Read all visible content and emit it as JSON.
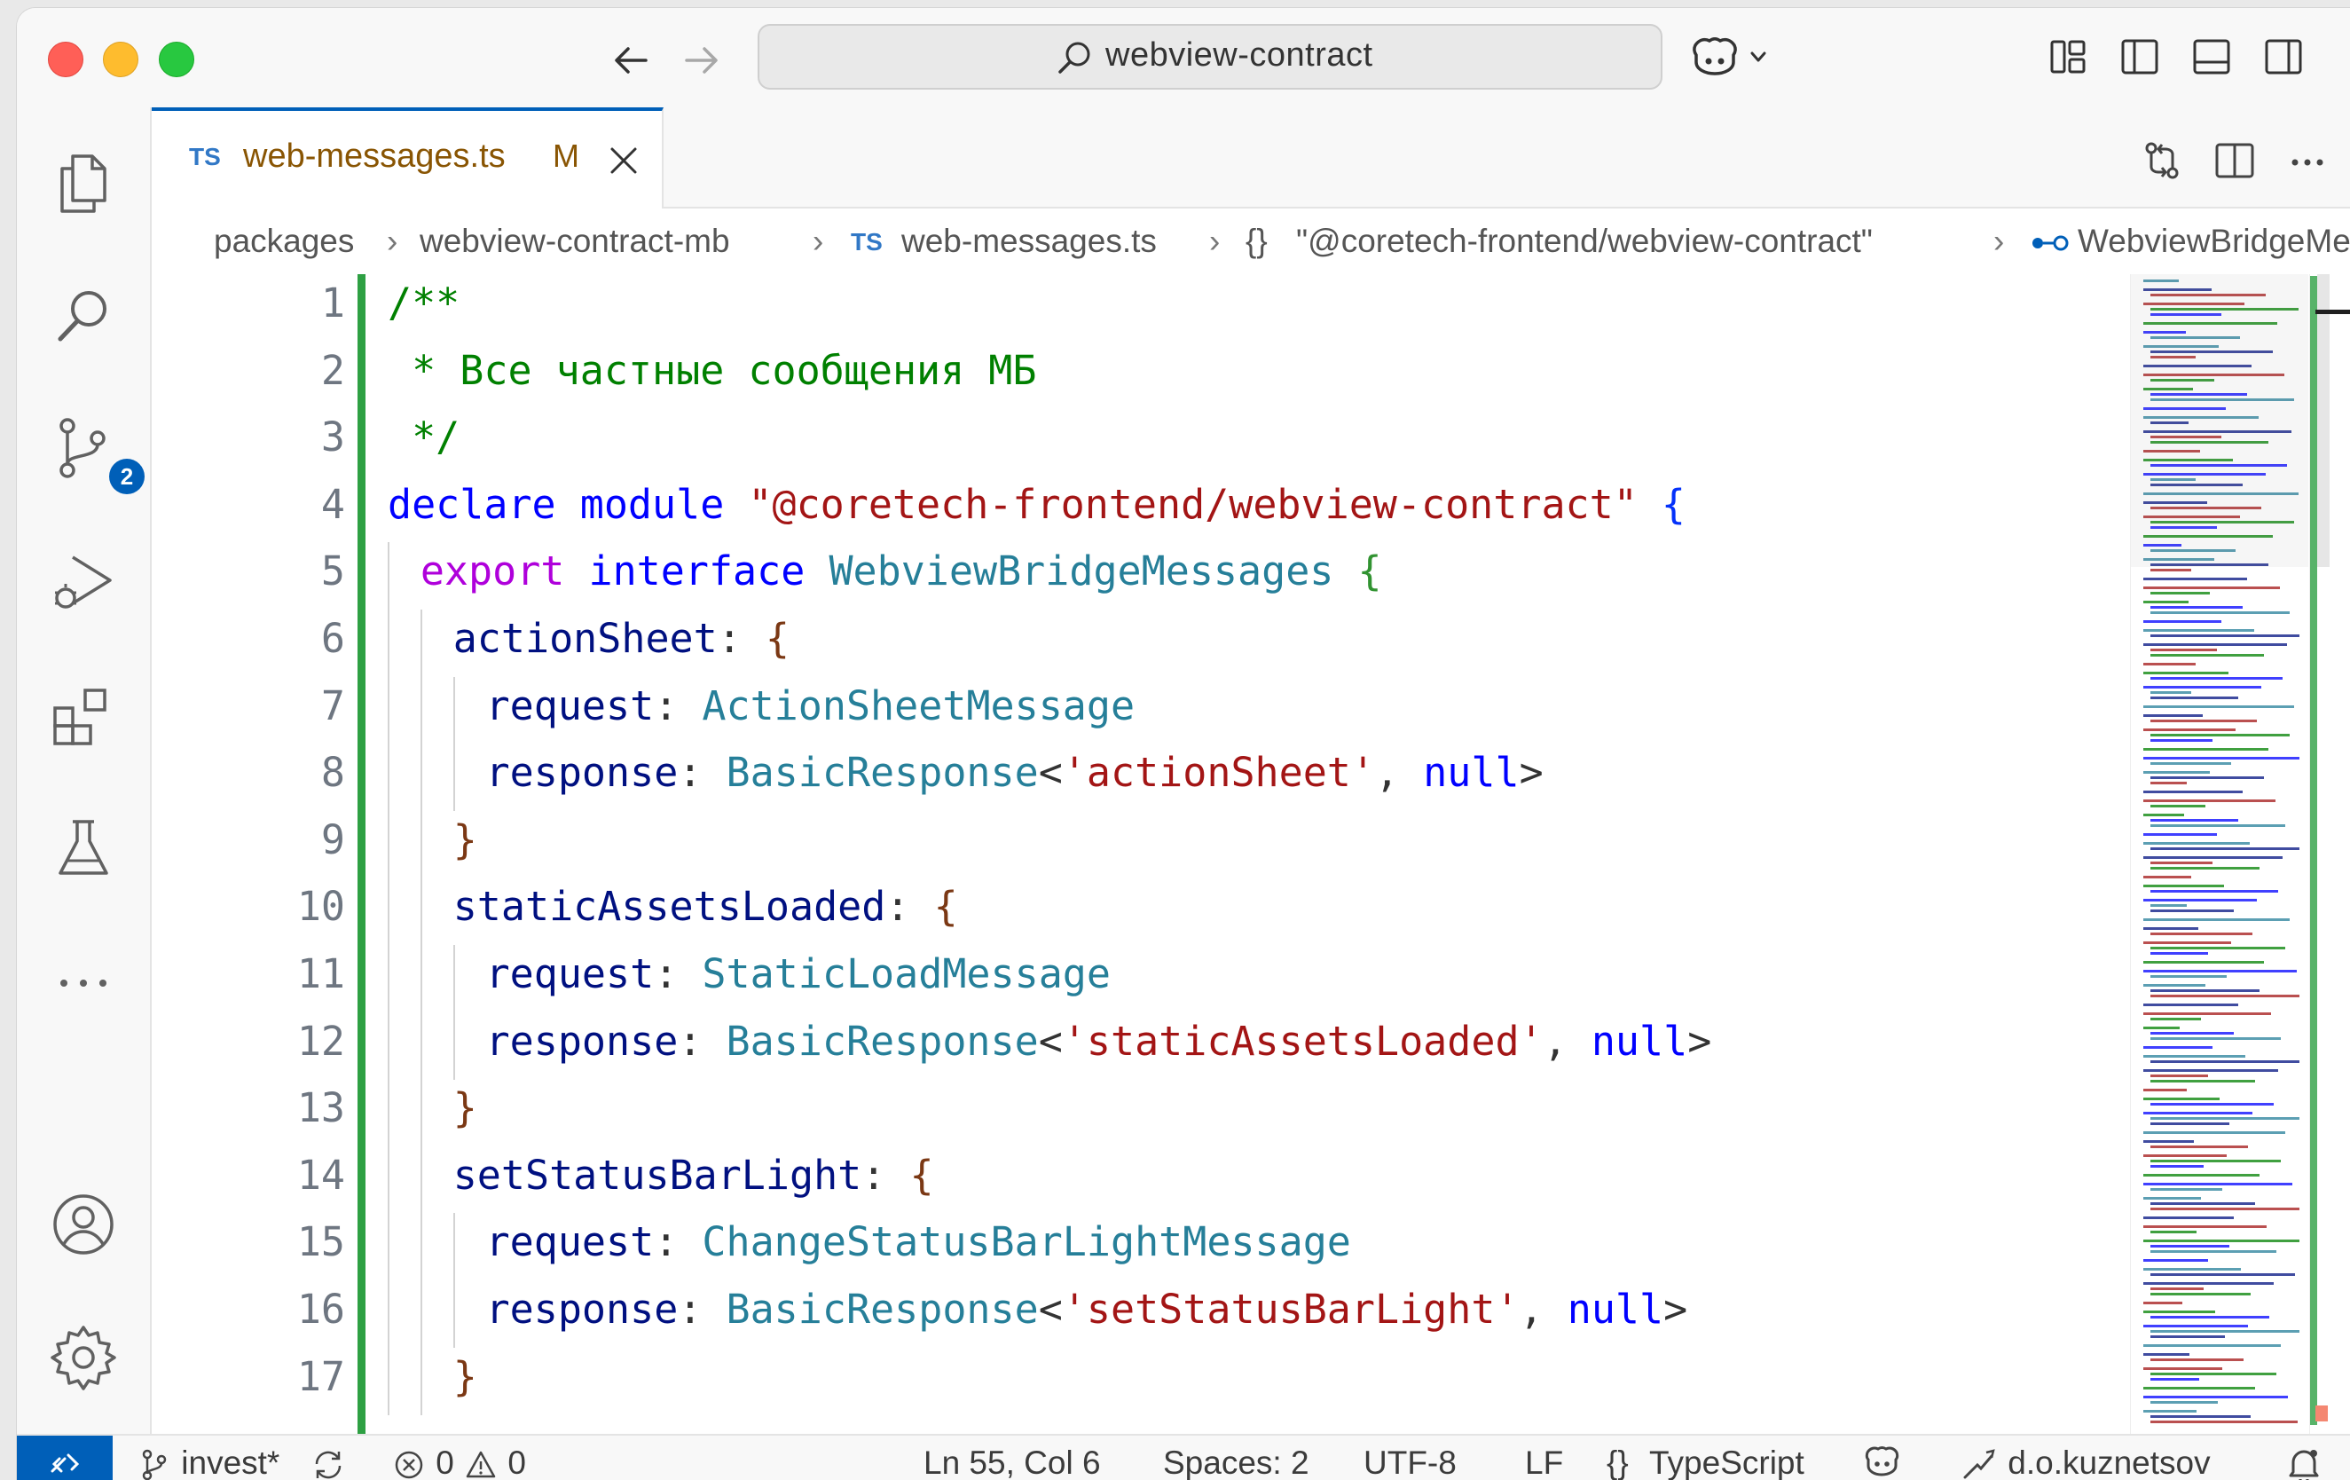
{
  "titlebar": {
    "command_center_text": "webview-contract"
  },
  "activity_bar": {
    "items": [
      "Explorer",
      "Search",
      "Source Control",
      "Run and Debug",
      "Extensions",
      "Testing",
      "More",
      "Accounts",
      "Manage"
    ],
    "scm_badge": "2"
  },
  "tab": {
    "lang": "TS",
    "file_name": "web-messages.ts",
    "modified_marker": "M"
  },
  "breadcrumbs": {
    "parts": [
      "packages",
      "webview-contract-mb",
      "web-messages.ts",
      "\"@coretech-frontend/webview-contract\"",
      "WebviewBridgeMessages"
    ],
    "file_lang": "TS",
    "module_symbol": "{}"
  },
  "editor": {
    "line_numbers": [
      "1",
      "2",
      "3",
      "4",
      "5",
      "6",
      "7",
      "8",
      "9",
      "10",
      "11",
      "12",
      "13",
      "14",
      "15",
      "16",
      "17"
    ],
    "lines": [
      {
        "t": "/**"
      },
      {
        "t": " * Все частные сообщения МБ"
      },
      {
        "t": " */"
      },
      {
        "a": "declare",
        "b": "module",
        "c": "\"@coretech-frontend/webview-contract\"",
        "d": "{"
      },
      {
        "a": "export",
        "b": "interface",
        "c": "WebviewBridgeMessages",
        "d": "{"
      },
      {
        "a": "actionSheet",
        "b": ":",
        "c": "{"
      },
      {
        "a": "request",
        "b": ":",
        "c": "ActionSheetMessage"
      },
      {
        "a": "response",
        "b": ":",
        "c": "BasicResponse",
        "d": "<",
        "e": "'actionSheet'",
        "f": ",",
        "g": "null",
        "h": ">"
      },
      {
        "a": "}"
      },
      {
        "a": "staticAssetsLoaded",
        "b": ":",
        "c": "{"
      },
      {
        "a": "request",
        "b": ":",
        "c": "StaticLoadMessage"
      },
      {
        "a": "response",
        "b": ":",
        "c": "BasicResponse",
        "d": "<",
        "e": "'staticAssetsLoaded'",
        "f": ",",
        "g": "null",
        "h": ">"
      },
      {
        "a": "}"
      },
      {
        "a": "setStatusBarLight",
        "b": ":",
        "c": "{"
      },
      {
        "a": "request",
        "b": ":",
        "c": "ChangeStatusBarLightMessage"
      },
      {
        "a": "response",
        "b": ":",
        "c": "BasicResponse",
        "d": "<",
        "e": "'setStatusBarLight'",
        "f": ",",
        "g": "null",
        "h": ">"
      },
      {
        "a": "}"
      }
    ]
  },
  "statusbar": {
    "branch": "invest*",
    "errors": "0",
    "warnings": "0",
    "cursor": "Ln 55, Col 6",
    "spaces": "Spaces: 2",
    "encoding": "UTF-8",
    "eol": "LF",
    "language": "TypeScript",
    "language_icon": "{}",
    "user": "d.o.kuznetsov"
  },
  "colors": {
    "accent": "#005fb8",
    "modified_tab": "#895503",
    "git_added_gutter": "#2ea043"
  }
}
